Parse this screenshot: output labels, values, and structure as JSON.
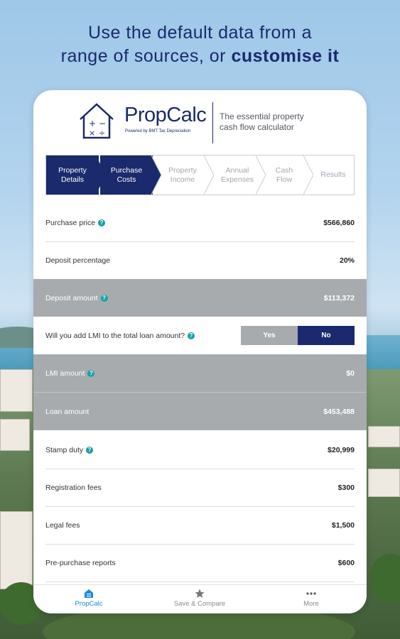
{
  "headline": {
    "line1": "Use the default data from a",
    "line2_plain": "range of sources, or",
    "line2_bold": "customise it"
  },
  "brand": {
    "name": "PropCalc",
    "sub": "Powered by BMT Tax Depreciation",
    "tagline": "The essential property cash flow calculator"
  },
  "steps": [
    {
      "label1": "Property",
      "label2": "Details",
      "active": true
    },
    {
      "label1": "Purchase",
      "label2": "Costs",
      "active": true
    },
    {
      "label1": "Property",
      "label2": "Income",
      "active": false
    },
    {
      "label1": "Annual",
      "label2": "Expenses",
      "active": false
    },
    {
      "label1": "Cash",
      "label2": "Flow",
      "active": false
    },
    {
      "label1": "Results",
      "label2": "",
      "active": false
    }
  ],
  "rows": {
    "purchase_price": {
      "label": "Purchase price",
      "value": "$566,860"
    },
    "deposit_percentage": {
      "label": "Deposit percentage",
      "value": "20%"
    },
    "deposit_amount": {
      "label": "Deposit amount",
      "value": "$113,372"
    },
    "lmi_question": {
      "label": "Will you add LMI to the total loan amount?",
      "yes": "Yes",
      "no": "No",
      "selected": "No"
    },
    "lmi_amount": {
      "label": "LMI amount",
      "value": "$0"
    },
    "loan_amount": {
      "label": "Loan amount",
      "value": "$453,488"
    },
    "stamp_duty": {
      "label": "Stamp duty",
      "value": "$20,999"
    },
    "registration_fees": {
      "label": "Registration fees",
      "value": "$300"
    },
    "legal_fees": {
      "label": "Legal fees",
      "value": "$1,500"
    },
    "pre_purchase_reports": {
      "label": "Pre-purchase reports",
      "value": "$600"
    }
  },
  "help_glyph": "?",
  "tabs": {
    "propcalc": "PropCalc",
    "save_compare": "Save & Compare",
    "more": "More"
  },
  "colors": {
    "brand_navy": "#1a2a6c",
    "grey_row": "#a8abad",
    "help_teal": "#1aa0a8",
    "tab_active": "#1a8ad6"
  }
}
